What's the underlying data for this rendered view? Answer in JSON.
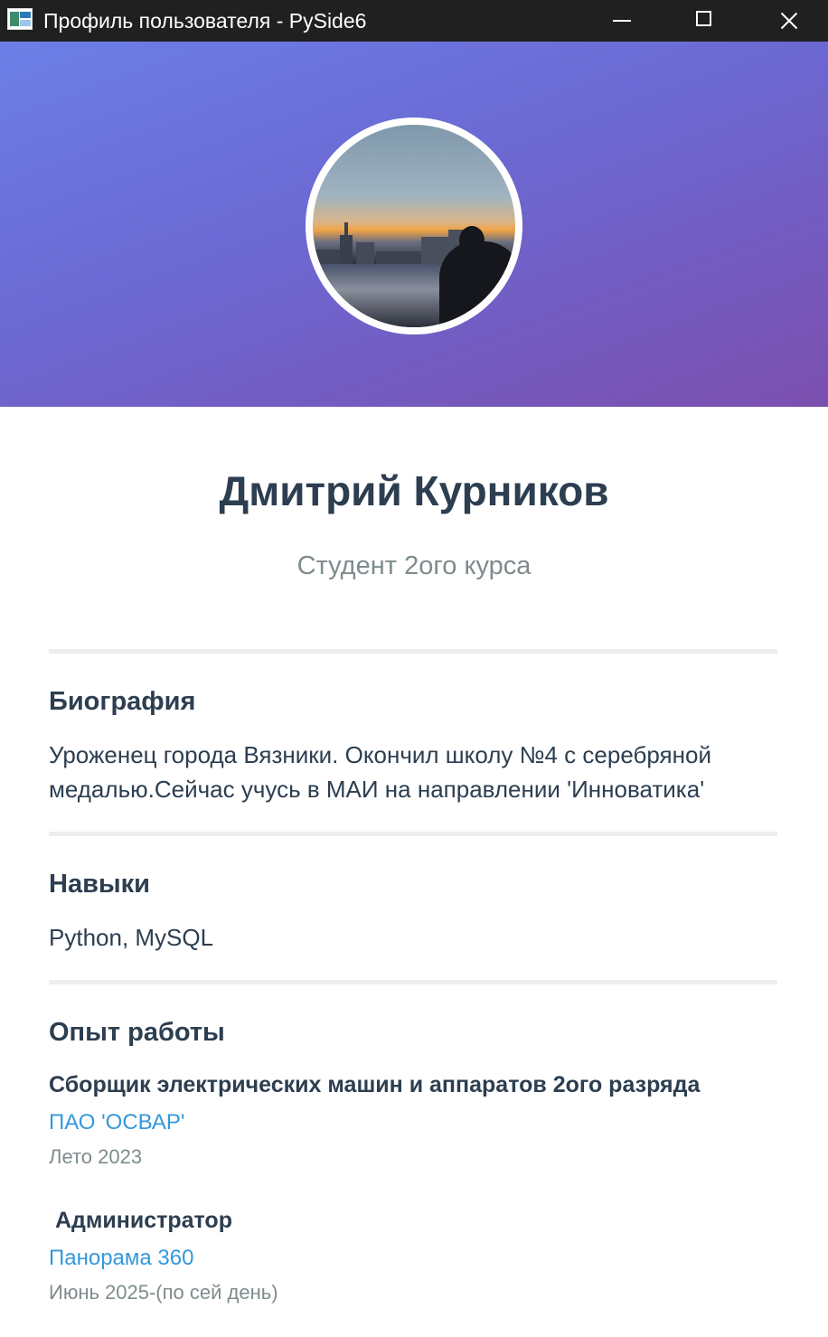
{
  "window": {
    "title": "Профиль пользователя - PySide6"
  },
  "profile": {
    "name": "Дмитрий Курников",
    "subtitle": "Студент 2ого курса"
  },
  "bio": {
    "title": "Биография",
    "text": "Уроженец города Вязники. Окончил школу №4 с серебряной медалью.Сейчас учусь в МАИ на направлении 'Инноватика'"
  },
  "skills": {
    "title": "Навыки",
    "text": "Python, MySQL"
  },
  "experience": {
    "title": "Опыт работы",
    "jobs": [
      {
        "position": "Сборщик электрических машин и аппаратов 2ого разряда",
        "company": "ПАО 'ОСВАР'",
        "period": "Лето 2023"
      },
      {
        "position": " Администратор",
        "company": "Панорама 360",
        "period": "Июнь 2025-(по сей день)"
      }
    ]
  },
  "colors": {
    "heading": "#2c3e50",
    "muted": "#7f8c8d",
    "link": "#3498db",
    "banner_start": "#6b7fe6",
    "banner_end": "#7b4fae"
  }
}
